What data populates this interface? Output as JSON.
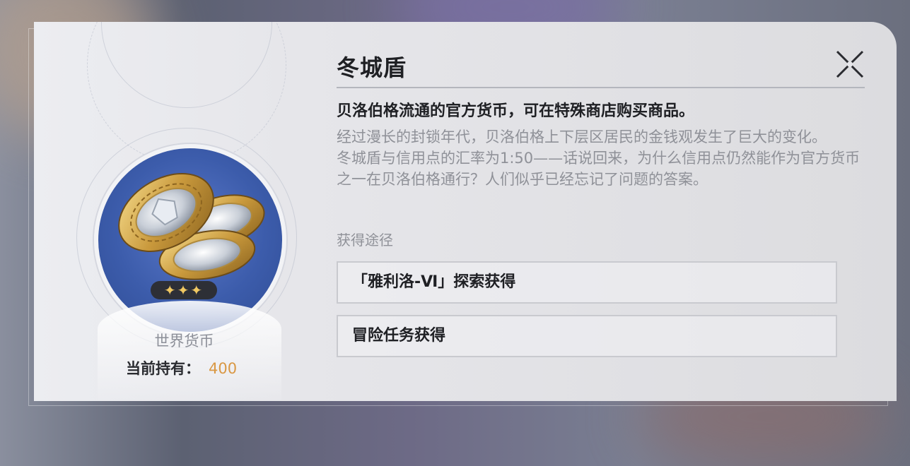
{
  "item": {
    "name": "冬城盾",
    "rarity_stars": "✦✦✦",
    "category": "世界货币",
    "owned_label": "当前持有：",
    "owned_count": "400"
  },
  "description": {
    "summary": "贝洛伯格流通的官方货币，可在特殊商店购买商品。",
    "lore_1": "经过漫长的封锁年代，贝洛伯格上下层区居民的金钱观发生了巨大的变化。",
    "lore_2": "冬城盾与信用点的汇率为1:50——话说回来，为什么信用点仍然能作为官方货币之一在贝洛伯格通行？人们似乎已经忘记了问题的答案。"
  },
  "acquisition": {
    "label": "获得途径",
    "sources": [
      "「雅利洛-Ⅵ」探索获得",
      "冒险任务获得"
    ]
  },
  "icons": {
    "close": "close-icon",
    "item": "coin-stack-icon"
  },
  "colors": {
    "accent_number": "#d99844",
    "disc_blue": "#3c5cab",
    "coin_gold": "#d4a94a"
  }
}
